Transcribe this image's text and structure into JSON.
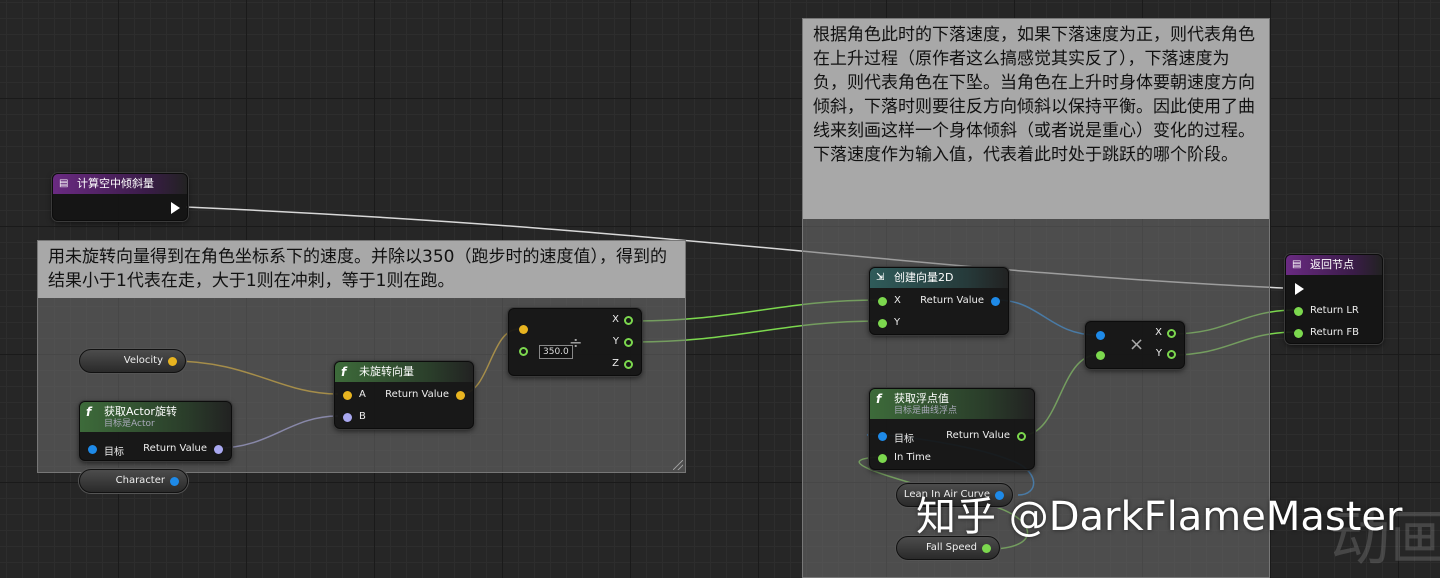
{
  "comments": {
    "left_note": "用未旋转向量得到在角色坐标系下的速度。并除以350（跑步时的速度值），得到的结果小于1代表在走，大于1则在冲刺，等于1则在跑。",
    "right_note": "根据角色此时的下落速度，如果下落速度为正，则代表角色在上升过程（原作者这么搞感觉其实反了），下落速度为负，则代表角色在下坠。当角色在上升时身体要朝速度方向倾斜，下落时则要往反方向倾斜以保持平衡。因此使用了曲线来刻画这样一个身体倾斜（或者说是重心）变化的过程。下落速度作为输入值，代表着此时处于跳跃的哪个阶段。"
  },
  "nodes": {
    "entry": {
      "title": "计算空中倾斜量"
    },
    "get_actor_rotation": {
      "title": "获取Actor旋转",
      "subtitle": "目标是Actor",
      "pin_target": "目标",
      "pin_return": "Return Value"
    },
    "unrotate": {
      "title": "未旋转向量",
      "pin_a": "A",
      "pin_b": "B",
      "pin_return": "Return Value"
    },
    "divide": {
      "symbol": "÷",
      "value": "350.0",
      "pin_x": "X",
      "pin_y": "Y",
      "pin_z": "Z"
    },
    "make_vector2d": {
      "title": "创建向量2D",
      "pin_x": "X",
      "pin_y": "Y",
      "pin_return": "Return Value"
    },
    "get_float": {
      "title": "获取浮点值",
      "subtitle": "目标是曲线浮点",
      "pin_target": "目标",
      "pin_time": "In Time",
      "pin_return": "Return Value"
    },
    "multiply": {
      "symbol": "×",
      "pin_x": "X",
      "pin_y": "Y"
    },
    "return": {
      "title": "返回节点",
      "pin_lr": "Return LR",
      "pin_fb": "Return FB"
    }
  },
  "variables": {
    "velocity": "Velocity",
    "character": "Character",
    "lean_in_air_curve": "Lean In Air Curve",
    "fall_speed": "Fall Speed"
  },
  "watermark": {
    "text": "知乎 @DarkFlameMaster",
    "extra": "动画"
  },
  "colors": {
    "exec": "#ffffff",
    "vector": "#e8b420",
    "float": "#7cd84e",
    "object": "#1e8ae8",
    "rotator": "#a9a8f0"
  }
}
